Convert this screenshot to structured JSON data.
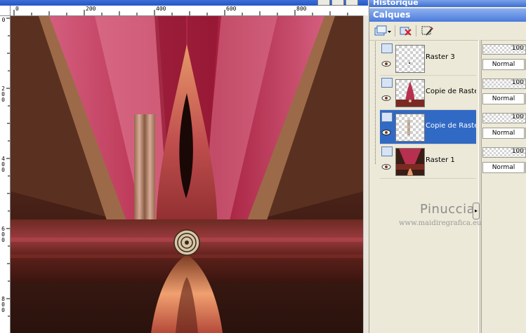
{
  "palette": {
    "history_title": "Historique",
    "layers_title": "Calques",
    "toolbar": [
      {
        "icon": "new-layer-icon",
        "label": "new layer"
      },
      {
        "icon": "delete-layer-icon",
        "label": "delete layer"
      },
      {
        "icon": "edit-selection-icon",
        "label": "edit selection"
      }
    ],
    "layers": [
      {
        "name": "Raster 3",
        "opacity": "100",
        "blend": "Normal",
        "selected": false
      },
      {
        "name": "Copie de Raster",
        "opacity": "100",
        "blend": "Normal",
        "selected": false
      },
      {
        "name": "Copie de Raster",
        "opacity": "100",
        "blend": "Normal",
        "selected": true
      },
      {
        "name": "Raster 1",
        "opacity": "100",
        "blend": "Normal",
        "selected": false
      }
    ],
    "collapse_glyph": "▸"
  },
  "watermark": {
    "name": "Pinuccia",
    "url": "www.maidiregrafica.eu"
  },
  "ruler": {
    "top_labels": [
      "0",
      "200",
      "400",
      "600",
      "800"
    ],
    "left_labels": [
      "0",
      "2 0 0",
      "4 0 0",
      "6 0 0",
      "8 0 0"
    ]
  },
  "colors": {
    "selected_row": "#316ac5",
    "title_bar": "#4a7bdc",
    "canvas_dark": "#2a1510",
    "canvas_pink": "#c24a6b"
  }
}
